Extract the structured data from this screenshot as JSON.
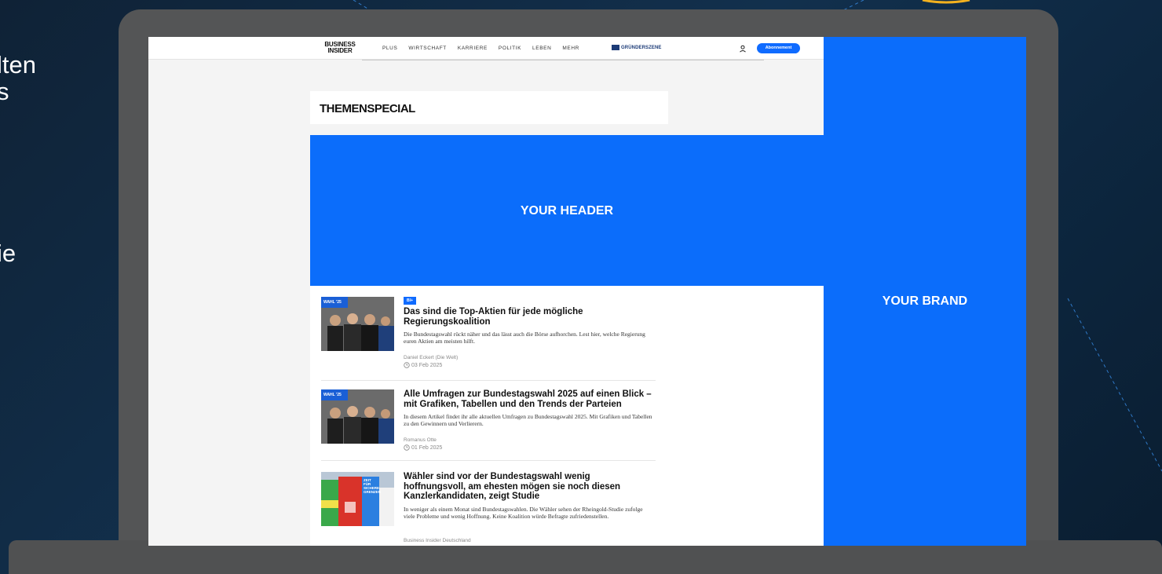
{
  "side_text": [
    "lten",
    "s",
    "ie"
  ],
  "navbar": {
    "logo_line1": "BUSINESS",
    "logo_line2": "INSIDER",
    "links": [
      "PLUS",
      "WIRTSCHAFT",
      "KARRIERE",
      "POLITIK",
      "LEBEN",
      "MEHR"
    ],
    "partner_label": "GRÜNDERSZENE",
    "user_icon": "user-icon",
    "subscribe_label": "Abonnement"
  },
  "brand_panel": {
    "label": "YOUR BRAND",
    "color": "#0b6dfb"
  },
  "themen": {
    "title": "THEMENSPECIAL"
  },
  "header_block": {
    "label": "YOUR HEADER",
    "color": "#0b6dfb"
  },
  "articles": [
    {
      "badge": "BI+",
      "title": "Das sind die Top-Aktien für jede mögliche Regierungskoalition",
      "description": "Die Bundestagswahl rückt näher und das lässt auch die Börse aufhorchen. Lest hier, welche Regierung euren Aktien am meisten hilft.",
      "author": "Daniel Eckert (Die Welt)",
      "date": "03 Feb 2025",
      "thumb_caption": "WAHL '25"
    },
    {
      "title": "Alle Umfragen zur Bundestagswahl 2025 auf einen Blick – mit Grafiken, Tabellen und den Trends der Parteien",
      "description": "In diesem Artikel findet ihr alle aktuellen Umfragen zu Bundestagswahl 2025. Mit Grafiken und Tabellen zu den Gewinnern und Verlierern.",
      "author": "Romanus Otte",
      "date": "01 Feb 2025",
      "thumb_caption": "WAHL '25"
    },
    {
      "title": "Wähler sind vor der Bundestagswahl wenig hoffnungsvoll, am ehesten mögen sie noch diesen Kanzlerkandidaten, zeigt Studie",
      "description": "In weniger als einem Monat sind Bundestagswahlen. Die Wähler sehen der Rheingold-Studie zufolge viele Probleme und wenig Hoffnung. Keine Koalition würde Befragte zufriedenstellen.",
      "author": "Business Insider Deutschland",
      "thumb_caption": "ZEIT FÜR SICHERE GRENZEN"
    }
  ],
  "colors": {
    "accent": "#0f6bff",
    "frame": "#545556"
  }
}
